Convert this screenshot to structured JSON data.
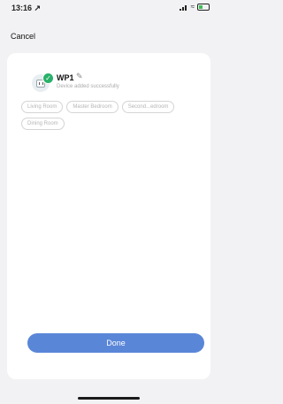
{
  "status_bar": {
    "time": "13:16 ↗"
  },
  "nav": {
    "cancel_label": "Cancel"
  },
  "device": {
    "name": "WP1",
    "status": "Device added successfully"
  },
  "rooms": [
    {
      "label": "Living Room"
    },
    {
      "label": "Master Bedroom"
    },
    {
      "label": "Second...edroom"
    },
    {
      "label": "Dining Room"
    }
  ],
  "actions": {
    "done_label": "Done"
  },
  "colors": {
    "accent": "#5a86d8",
    "success": "#29b16a"
  }
}
